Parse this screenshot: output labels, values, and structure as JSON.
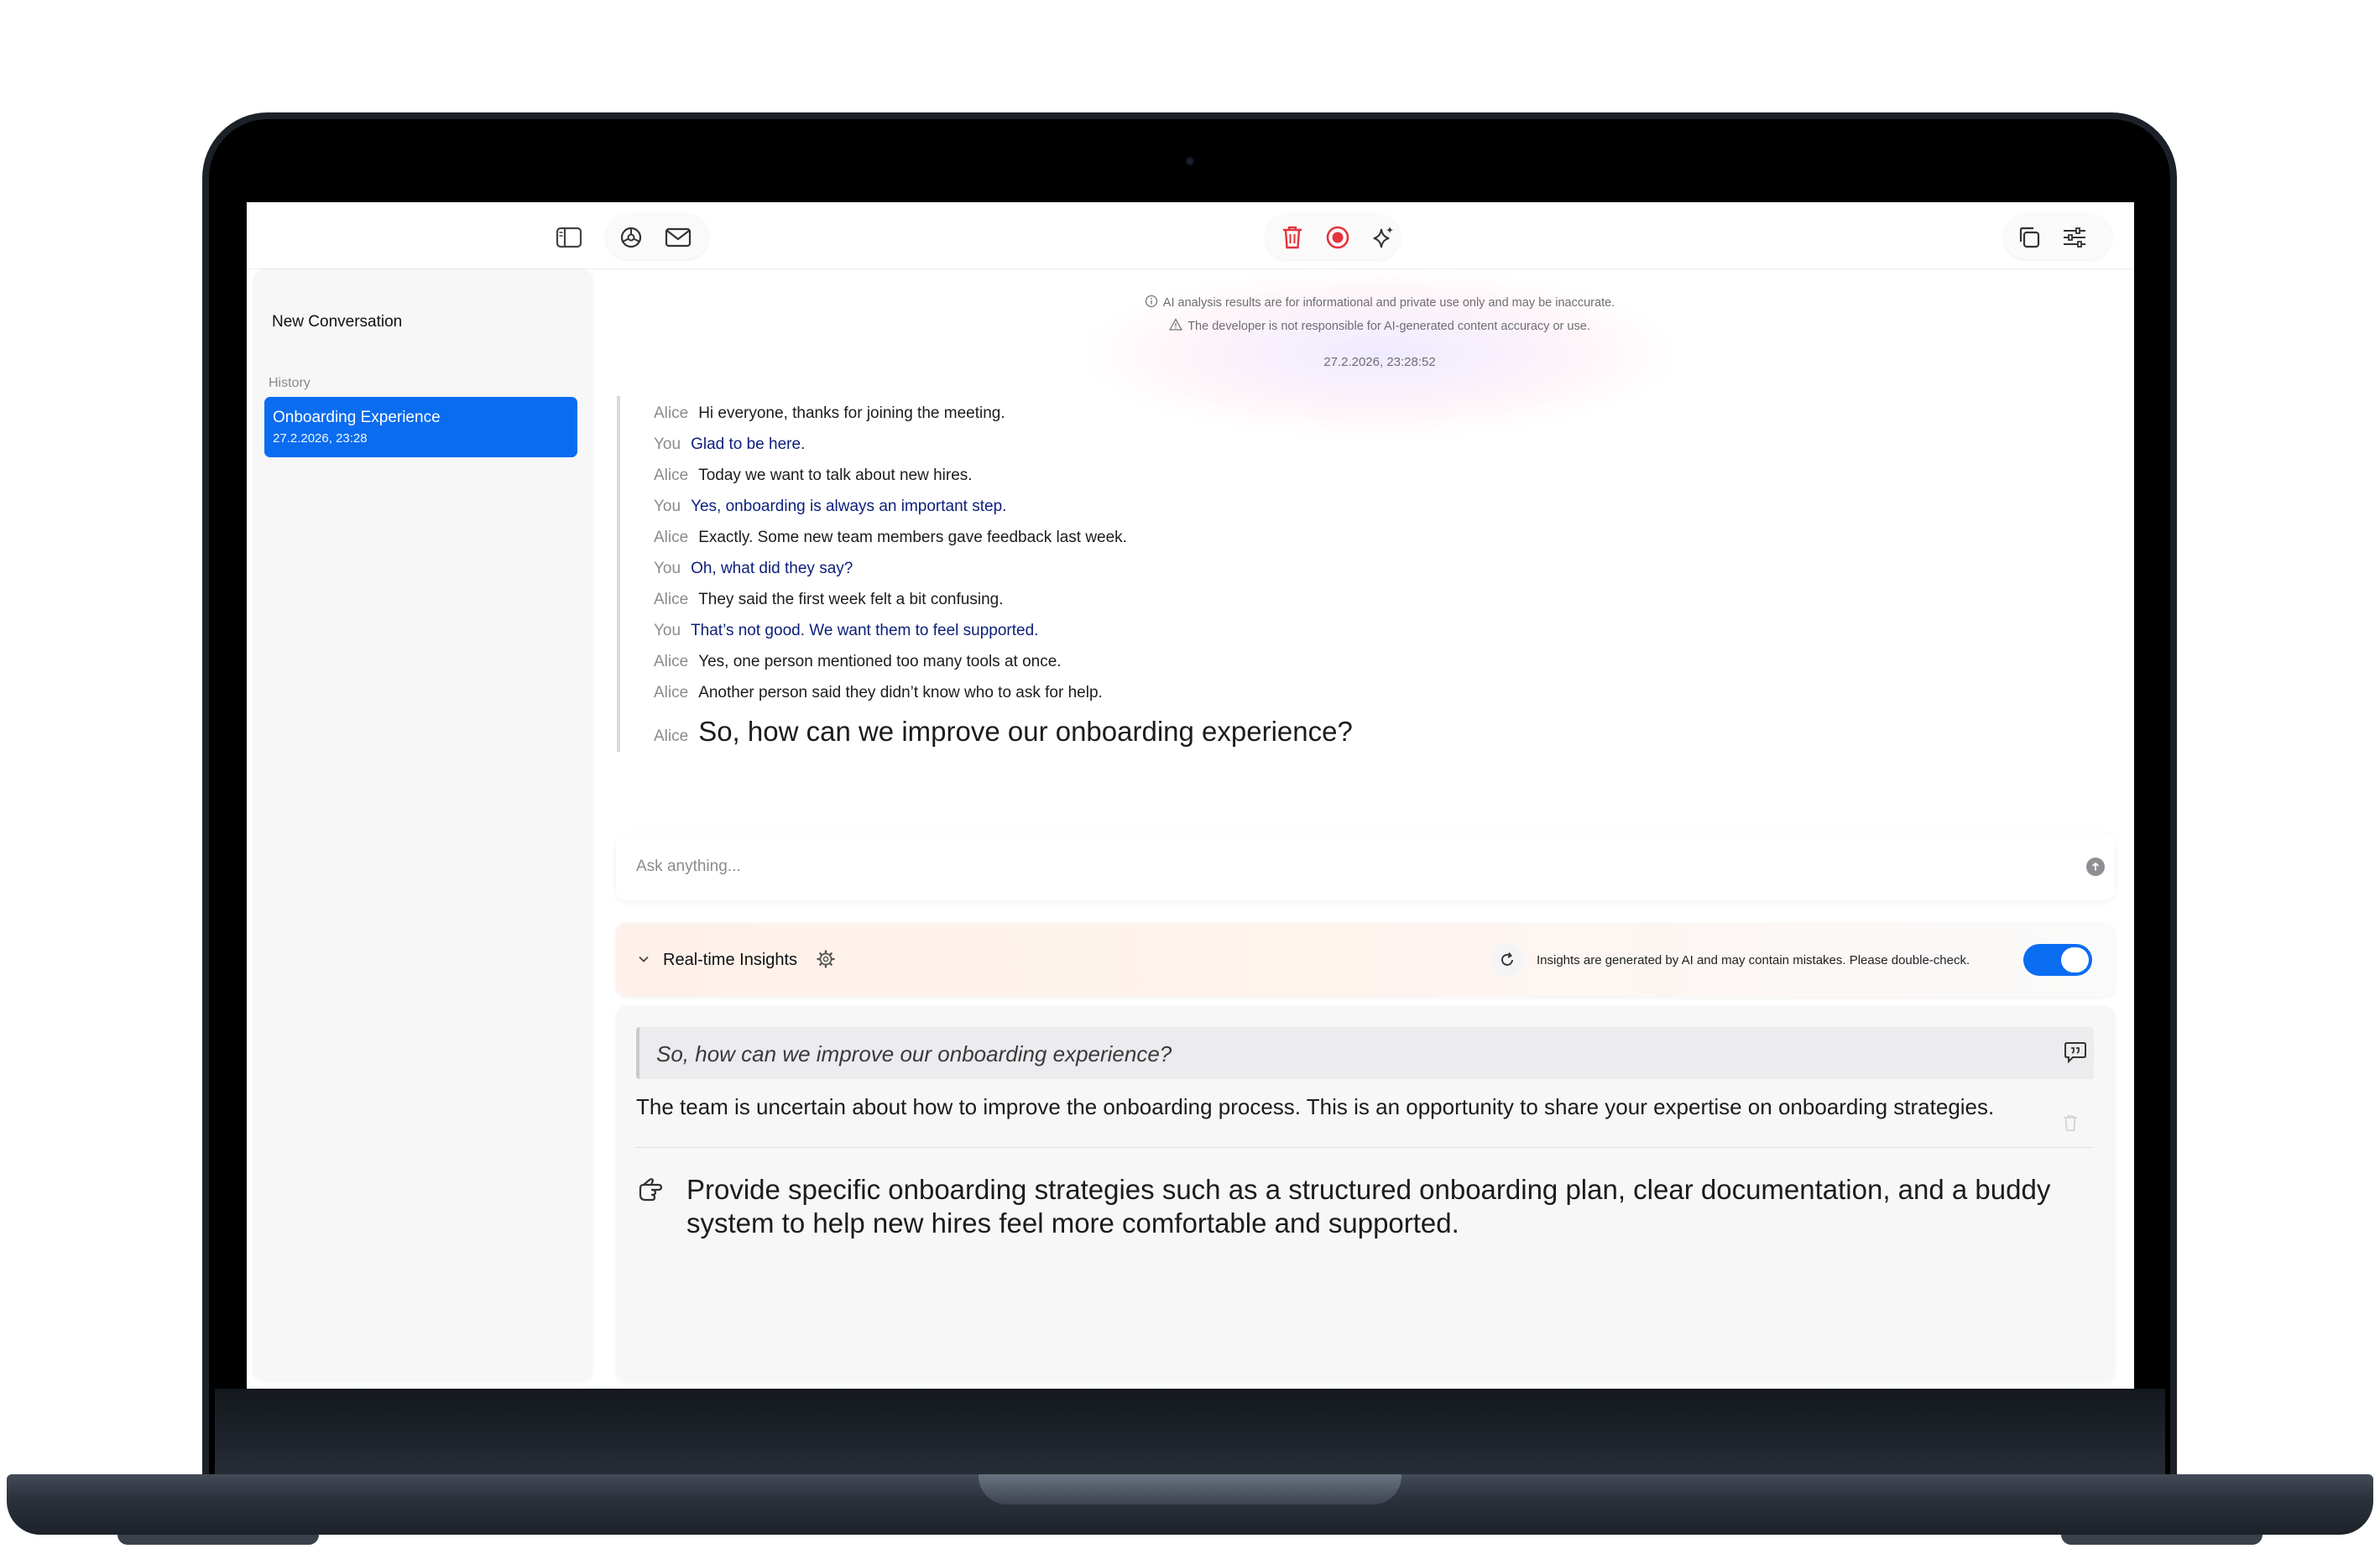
{
  "toolbar": {
    "left_icons": [
      "sidebar-toggle-icon",
      "settings-wheel-icon",
      "mail-icon"
    ],
    "center_icons": [
      "trash-icon",
      "record-icon",
      "sparkle-icon"
    ],
    "right_icons": [
      "copy-icon",
      "sliders-icon"
    ],
    "accent_red": "#e5323b"
  },
  "sidebar": {
    "new_conversation": "New Conversation",
    "history_label": "History",
    "items": [
      {
        "title": "Onboarding Experience",
        "date": "27.2.2026, 23:28",
        "selected": true
      }
    ],
    "accent_color": "#0a6cf0"
  },
  "disclaimer": {
    "line1": "AI analysis results are for informational and private use only and may be inaccurate.",
    "line2": "The developer is not responsible for AI-generated content accuracy or use.",
    "timestamp": "27.2.2026, 23:28:52"
  },
  "transcript": [
    {
      "speaker": "Alice",
      "text": "Hi everyone, thanks for joining the meeting."
    },
    {
      "speaker": "You",
      "text": "Glad to be here."
    },
    {
      "speaker": "Alice",
      "text": "Today we want to talk about new hires."
    },
    {
      "speaker": "You",
      "text": "Yes, onboarding is always an important step."
    },
    {
      "speaker": "Alice",
      "text": "Exactly. Some new team members gave feedback last week."
    },
    {
      "speaker": "You",
      "text": "Oh, what did they say?"
    },
    {
      "speaker": "Alice",
      "text": "They said the first week felt a bit confusing."
    },
    {
      "speaker": "You",
      "text": "That’s not good. We want them to feel supported."
    },
    {
      "speaker": "Alice",
      "text": "Yes, one person mentioned too many tools at once."
    },
    {
      "speaker": "Alice",
      "text": "Another person said they didn’t know who to ask for help."
    },
    {
      "speaker": "Alice",
      "text": "So, how can we improve our onboarding experience?"
    }
  ],
  "ask": {
    "placeholder": "Ask anything..."
  },
  "insights": {
    "title": "Real-time Insights",
    "note": "Insights are generated by AI and may contain mistakes. Please double-check.",
    "toggle_on": true,
    "quote": "So, how can we improve our onboarding experience?",
    "summary": "The team is uncertain about how to improve the onboarding process. This is an opportunity to share your expertise on onboarding strategies.",
    "suggestion": "Provide specific onboarding strategies such as a structured onboarding plan, clear documentation, and a buddy system to help new hires feel more comfortable and supported."
  }
}
